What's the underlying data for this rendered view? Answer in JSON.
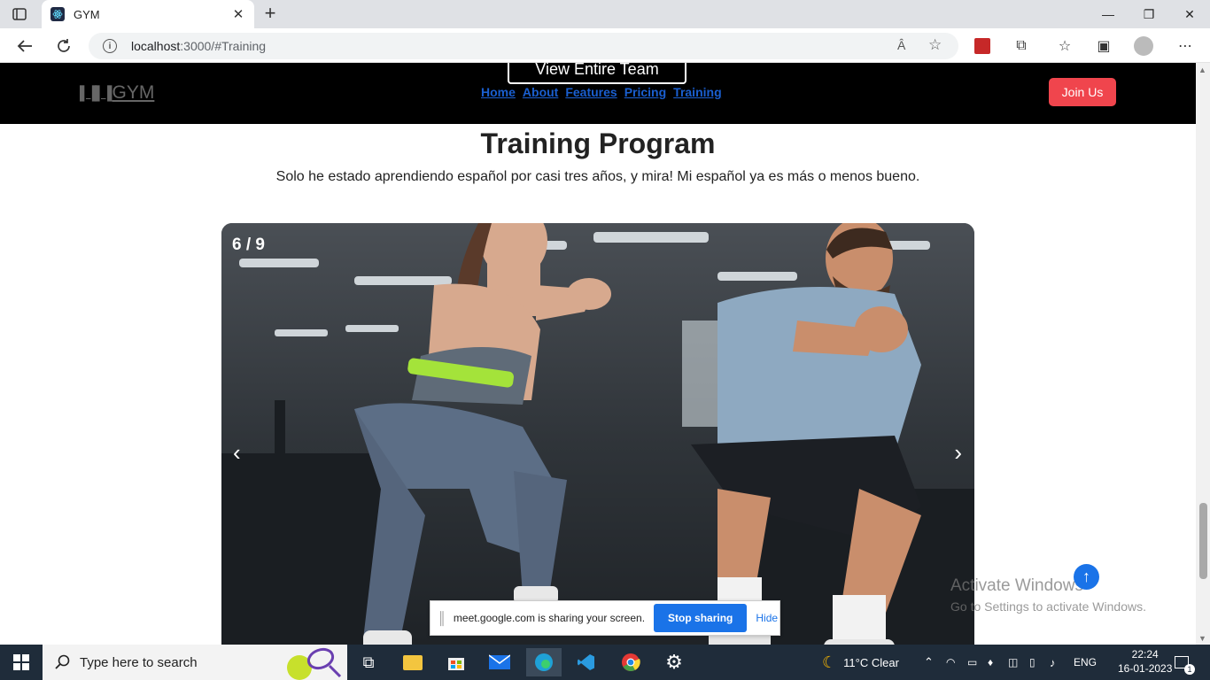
{
  "browser": {
    "tab_title": "GYM",
    "url_host": "localhost",
    "url_path": ":3000/#Training",
    "read_aloud_icon": "Â",
    "new_tab": "+"
  },
  "site": {
    "top_button": "View Entire Team",
    "logo": "GYM",
    "nav": [
      "Home",
      "About",
      "Features",
      "Pricing",
      "Training"
    ],
    "join": "Join Us",
    "heading": "Training Program",
    "subtitle": "Solo he estado aprendiendo español por casi tres años, y mira! Mi español ya es más o menos bueno.",
    "slide_counter": "6 / 9",
    "prev": "‹",
    "next": "›"
  },
  "overlays": {
    "activate_title": "Activate Windows",
    "activate_sub": "Go to Settings to activate Windows.",
    "share_msg": "meet.google.com is sharing your screen.",
    "share_stop": "Stop sharing",
    "share_hide": "Hide"
  },
  "taskbar": {
    "search_placeholder": "Type here to search",
    "weather": "11°C  Clear",
    "lang": "ENG",
    "time": "22:24",
    "date": "16-01-2023",
    "notifications": "1"
  }
}
